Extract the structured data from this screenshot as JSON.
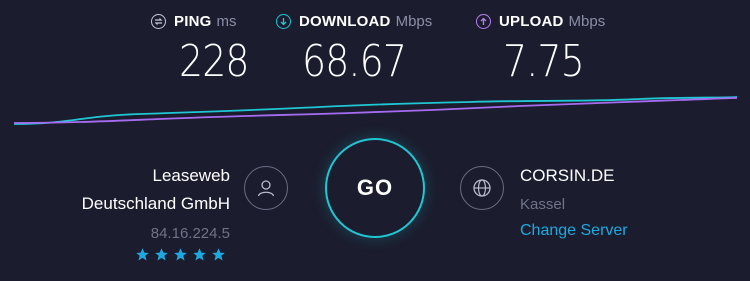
{
  "colors": {
    "background": "#1b1d2e",
    "ping": "#c7c9d6",
    "download": "#1fc7d4",
    "upload": "#b67ff5",
    "link": "#1fa8e0",
    "star": "#1fa8e0"
  },
  "metrics": {
    "ping": {
      "label": "PING",
      "unit": "ms",
      "value": "228",
      "icon": "ping-icon"
    },
    "download": {
      "label": "DOWNLOAD",
      "unit": "Mbps",
      "value": "68.67",
      "icon": "download-arrow-icon"
    },
    "upload": {
      "label": "UPLOAD",
      "unit": "Mbps",
      "value": "7.75",
      "icon": "upload-arrow-icon"
    }
  },
  "isp": {
    "name_line1": "Leaseweb",
    "name_line2": "Deutschland GmbH",
    "ip": "84.16.224.5",
    "rating": 5,
    "rating_max": 5,
    "icon": "user-icon"
  },
  "go_button": {
    "label": "GO"
  },
  "server": {
    "name": "CORSIN.DE",
    "location": "Kassel",
    "change_label": "Change Server",
    "icon": "globe-icon"
  }
}
